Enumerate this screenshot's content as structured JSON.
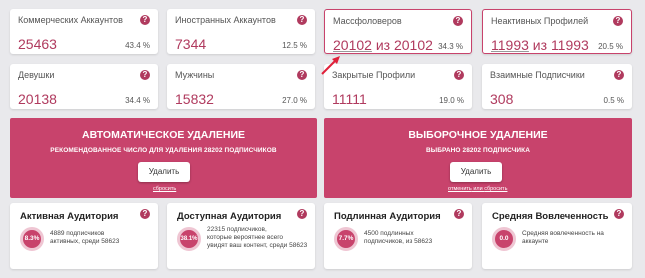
{
  "stats": [
    {
      "title": "Коммерческих Аккаунтов",
      "value": "25463",
      "pct": "43.4 %"
    },
    {
      "title": "Иностранных Аккаунтов",
      "value": "7344",
      "pct": "12.5 %"
    },
    {
      "title": "Массфоловеров",
      "value_a": "20102",
      "value_mid": " из ",
      "value_b": "20102",
      "pct": "34.3 %"
    },
    {
      "title": "Неактивных Профилей",
      "value_a": "11993",
      "value_mid": " из ",
      "value_b": "11993",
      "pct": "20.5 %"
    },
    {
      "title": "Девушки",
      "value": "20138",
      "pct": "34.4 %"
    },
    {
      "title": "Мужчины",
      "value": "15832",
      "pct": "27.0 %"
    },
    {
      "title": "Закрытые Профили",
      "value": "11111",
      "pct": "19.0 %"
    },
    {
      "title": "Взаимные Подписчики",
      "value": "308",
      "pct": "0.5 %"
    }
  ],
  "help_icon": "?",
  "auto_delete": {
    "title": "АВТОМАТИЧЕСКОЕ УДАЛЕНИЕ",
    "subtitle": "РЕКОМЕНДОВАННОЕ ЧИСЛО ДЛЯ УДАЛЕНИЯ 28202 ПОДПИСЧИКОВ",
    "button": "Удалить",
    "link": "сбросить"
  },
  "selective_delete": {
    "title": "ВЫБОРОЧНОЕ УДАЛЕНИЕ",
    "subtitle": "ВЫБРАНО 28202 ПОДПИСЧИКА",
    "button": "Удалить",
    "link_left": "отменить",
    "link_mid": " или ",
    "link_right": "сбросить"
  },
  "audience": [
    {
      "title": "Активная Аудитория",
      "circle": "8.3%",
      "desc1": "4889 подписчиков",
      "desc2": "активных, среди 58623",
      "desc3": ""
    },
    {
      "title": "Доступная Аудитория",
      "circle": "38.1%",
      "desc1": "22315 подписчиков,",
      "desc2": "которые вероятнее всего",
      "desc3": "увидят ваш контент, среди 58623"
    },
    {
      "title": "Подлинная Аудитория",
      "circle": "7.7%",
      "desc1": "4500 подлинных",
      "desc2": "подписчиков, из 58623",
      "desc3": ""
    },
    {
      "title": "Средняя Вовлеченность",
      "circle": "0.0",
      "desc1": "Средняя вовлеченность на",
      "desc2": "аккаунте",
      "desc3": ""
    }
  ],
  "colors": {
    "accent": "#c8436c",
    "value": "#b03a5e",
    "arrow": "#e0213a"
  }
}
